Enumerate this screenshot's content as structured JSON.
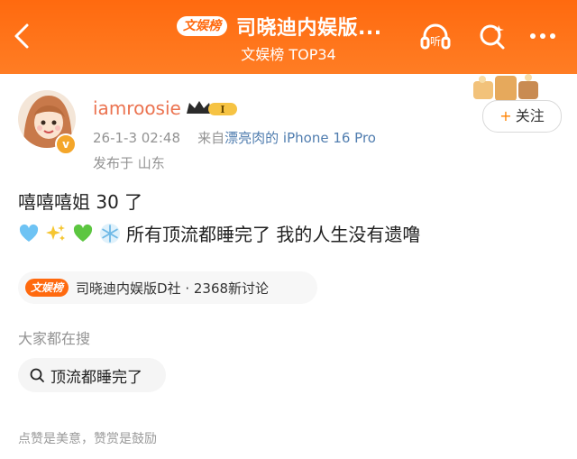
{
  "header": {
    "badge": "文娱榜",
    "title": "司晓迪内娱版...",
    "subtitle": "文娱榜 TOP34",
    "listen_icon_label": "听"
  },
  "post": {
    "username": "iamroosie",
    "vip_level": "I",
    "date": "26-1-3 02:48",
    "from_prefix": "来自",
    "from_link": "漂亮肉的",
    "device": "iPhone 16 Pro",
    "location": "发布于 山东",
    "follow_label": "关注",
    "line1": "嘻嘻嘻姐 30 了",
    "line2": "所有顶流都睡完了 我的人生没有遗噜",
    "emojis": [
      "blue-heart-icon",
      "sparkles-icon",
      "green-heart-icon",
      "snowflake-icon"
    ]
  },
  "topic": {
    "badge": "文娱榜",
    "text": "司晓迪内娱版D社 · 2368新讨论"
  },
  "search": {
    "heading": "大家都在搜",
    "chip": "顶流都睡完了"
  },
  "footer": {
    "tip": "点赞是美意，赞赏是鼓励"
  },
  "colors": {
    "brand_orange": "#ff6a0f",
    "username": "#eb7350",
    "link_blue": "#507daf"
  }
}
